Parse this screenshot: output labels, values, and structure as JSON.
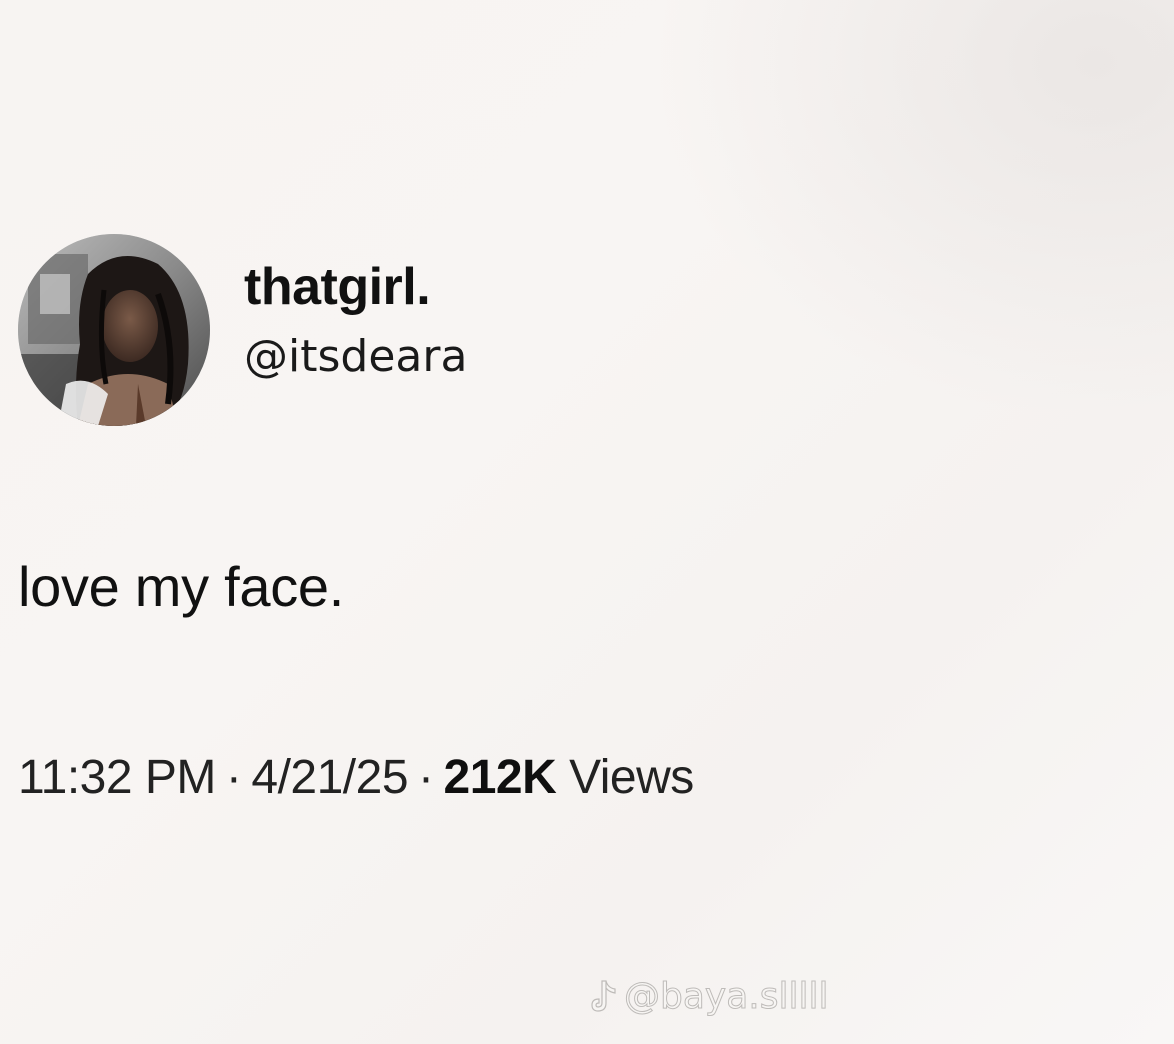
{
  "tweet": {
    "author": {
      "display_name": "thatgirl.",
      "handle": "@itsdeara"
    },
    "text": "love my face.",
    "meta": {
      "time": "11:32 PM",
      "date": "4/21/25",
      "separator": "·",
      "views_count": "212K",
      "views_label": "Views"
    }
  },
  "watermark": {
    "icon": "tiktok-icon",
    "text": "@baya.slllll"
  }
}
